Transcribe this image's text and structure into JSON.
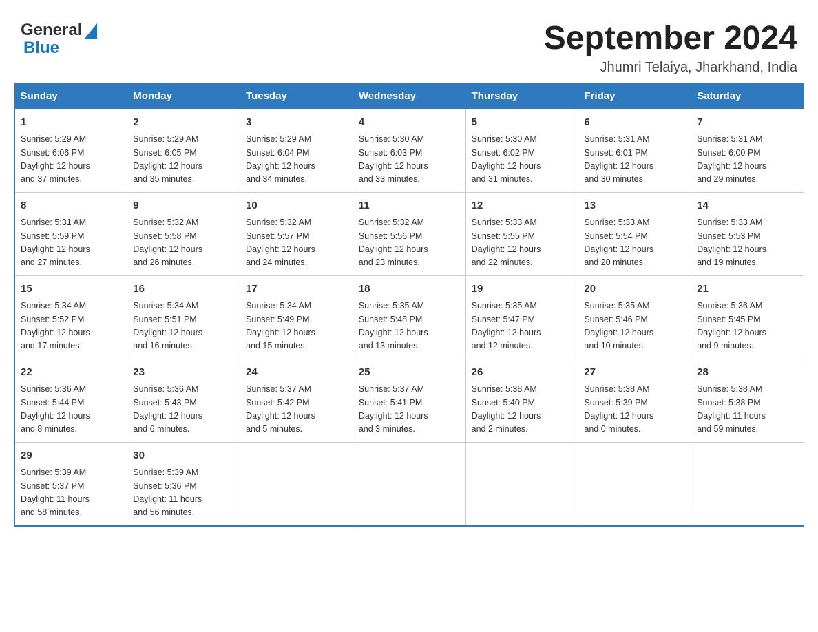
{
  "header": {
    "logo_general": "General",
    "logo_blue": "Blue",
    "month_title": "September 2024",
    "location": "Jhumri Telaiya, Jharkhand, India"
  },
  "weekdays": [
    "Sunday",
    "Monday",
    "Tuesday",
    "Wednesday",
    "Thursday",
    "Friday",
    "Saturday"
  ],
  "weeks": [
    [
      {
        "day": "1",
        "sunrise": "5:29 AM",
        "sunset": "6:06 PM",
        "daylight": "12 hours and 37 minutes."
      },
      {
        "day": "2",
        "sunrise": "5:29 AM",
        "sunset": "6:05 PM",
        "daylight": "12 hours and 35 minutes."
      },
      {
        "day": "3",
        "sunrise": "5:29 AM",
        "sunset": "6:04 PM",
        "daylight": "12 hours and 34 minutes."
      },
      {
        "day": "4",
        "sunrise": "5:30 AM",
        "sunset": "6:03 PM",
        "daylight": "12 hours and 33 minutes."
      },
      {
        "day": "5",
        "sunrise": "5:30 AM",
        "sunset": "6:02 PM",
        "daylight": "12 hours and 31 minutes."
      },
      {
        "day": "6",
        "sunrise": "5:31 AM",
        "sunset": "6:01 PM",
        "daylight": "12 hours and 30 minutes."
      },
      {
        "day": "7",
        "sunrise": "5:31 AM",
        "sunset": "6:00 PM",
        "daylight": "12 hours and 29 minutes."
      }
    ],
    [
      {
        "day": "8",
        "sunrise": "5:31 AM",
        "sunset": "5:59 PM",
        "daylight": "12 hours and 27 minutes."
      },
      {
        "day": "9",
        "sunrise": "5:32 AM",
        "sunset": "5:58 PM",
        "daylight": "12 hours and 26 minutes."
      },
      {
        "day": "10",
        "sunrise": "5:32 AM",
        "sunset": "5:57 PM",
        "daylight": "12 hours and 24 minutes."
      },
      {
        "day": "11",
        "sunrise": "5:32 AM",
        "sunset": "5:56 PM",
        "daylight": "12 hours and 23 minutes."
      },
      {
        "day": "12",
        "sunrise": "5:33 AM",
        "sunset": "5:55 PM",
        "daylight": "12 hours and 22 minutes."
      },
      {
        "day": "13",
        "sunrise": "5:33 AM",
        "sunset": "5:54 PM",
        "daylight": "12 hours and 20 minutes."
      },
      {
        "day": "14",
        "sunrise": "5:33 AM",
        "sunset": "5:53 PM",
        "daylight": "12 hours and 19 minutes."
      }
    ],
    [
      {
        "day": "15",
        "sunrise": "5:34 AM",
        "sunset": "5:52 PM",
        "daylight": "12 hours and 17 minutes."
      },
      {
        "day": "16",
        "sunrise": "5:34 AM",
        "sunset": "5:51 PM",
        "daylight": "12 hours and 16 minutes."
      },
      {
        "day": "17",
        "sunrise": "5:34 AM",
        "sunset": "5:49 PM",
        "daylight": "12 hours and 15 minutes."
      },
      {
        "day": "18",
        "sunrise": "5:35 AM",
        "sunset": "5:48 PM",
        "daylight": "12 hours and 13 minutes."
      },
      {
        "day": "19",
        "sunrise": "5:35 AM",
        "sunset": "5:47 PM",
        "daylight": "12 hours and 12 minutes."
      },
      {
        "day": "20",
        "sunrise": "5:35 AM",
        "sunset": "5:46 PM",
        "daylight": "12 hours and 10 minutes."
      },
      {
        "day": "21",
        "sunrise": "5:36 AM",
        "sunset": "5:45 PM",
        "daylight": "12 hours and 9 minutes."
      }
    ],
    [
      {
        "day": "22",
        "sunrise": "5:36 AM",
        "sunset": "5:44 PM",
        "daylight": "12 hours and 8 minutes."
      },
      {
        "day": "23",
        "sunrise": "5:36 AM",
        "sunset": "5:43 PM",
        "daylight": "12 hours and 6 minutes."
      },
      {
        "day": "24",
        "sunrise": "5:37 AM",
        "sunset": "5:42 PM",
        "daylight": "12 hours and 5 minutes."
      },
      {
        "day": "25",
        "sunrise": "5:37 AM",
        "sunset": "5:41 PM",
        "daylight": "12 hours and 3 minutes."
      },
      {
        "day": "26",
        "sunrise": "5:38 AM",
        "sunset": "5:40 PM",
        "daylight": "12 hours and 2 minutes."
      },
      {
        "day": "27",
        "sunrise": "5:38 AM",
        "sunset": "5:39 PM",
        "daylight": "12 hours and 0 minutes."
      },
      {
        "day": "28",
        "sunrise": "5:38 AM",
        "sunset": "5:38 PM",
        "daylight": "11 hours and 59 minutes."
      }
    ],
    [
      {
        "day": "29",
        "sunrise": "5:39 AM",
        "sunset": "5:37 PM",
        "daylight": "11 hours and 58 minutes."
      },
      {
        "day": "30",
        "sunrise": "5:39 AM",
        "sunset": "5:36 PM",
        "daylight": "11 hours and 56 minutes."
      },
      null,
      null,
      null,
      null,
      null
    ]
  ],
  "labels": {
    "sunrise": "Sunrise:",
    "sunset": "Sunset:",
    "daylight": "Daylight:"
  }
}
